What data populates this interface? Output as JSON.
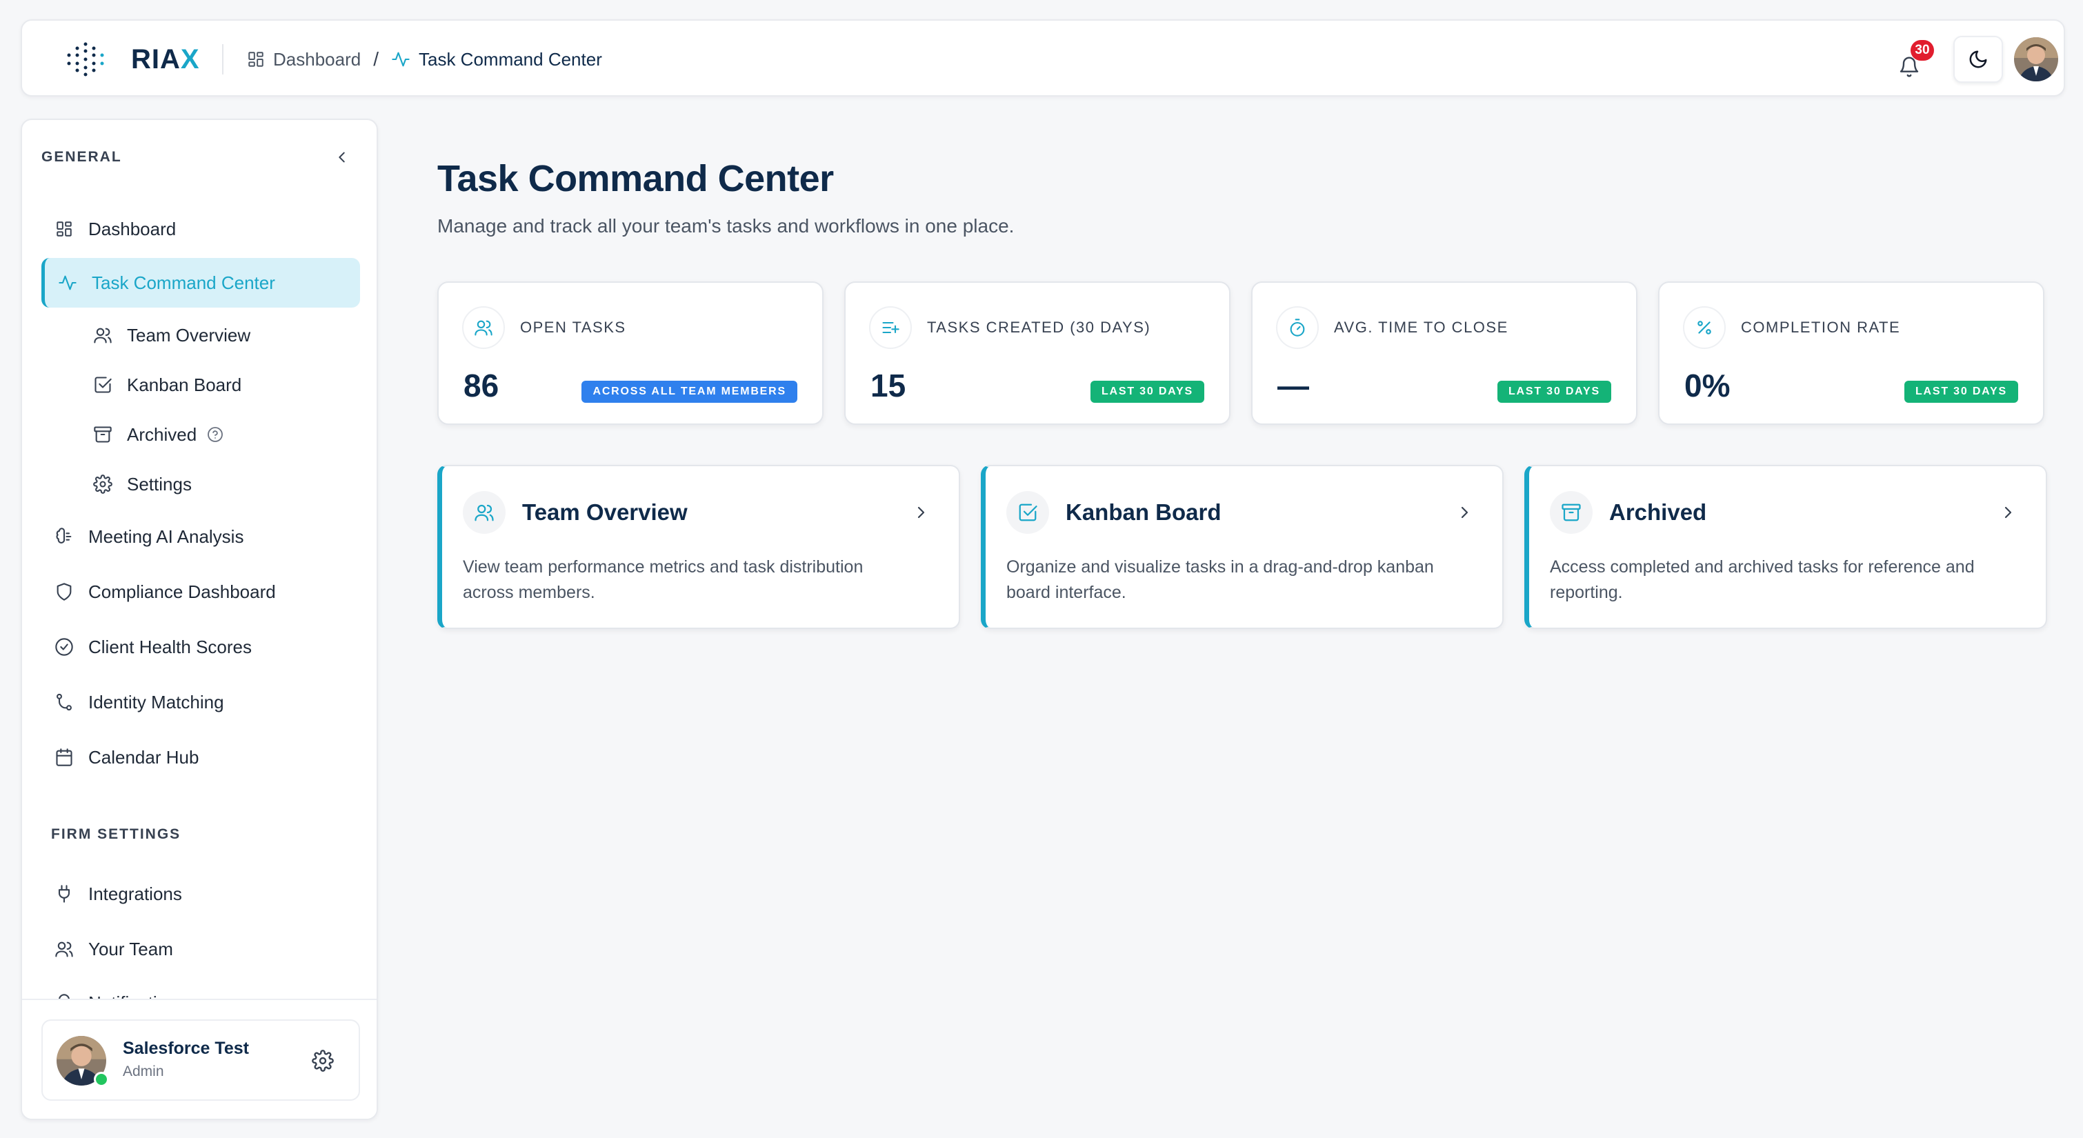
{
  "header": {
    "brand": "RIA",
    "brand_accent": "X",
    "breadcrumb": [
      {
        "label": "Dashboard"
      },
      {
        "label": "Task Command Center"
      }
    ],
    "breadcrumb_separator": "/",
    "notification_count": "30"
  },
  "sidebar": {
    "general_label": "GENERAL",
    "items": [
      {
        "label": "Dashboard"
      },
      {
        "label": "Task Command Center"
      },
      {
        "label": "Team Overview"
      },
      {
        "label": "Kanban Board"
      },
      {
        "label": "Archived"
      },
      {
        "label": "Settings"
      },
      {
        "label": "Meeting AI Analysis"
      },
      {
        "label": "Compliance Dashboard"
      },
      {
        "label": "Client Health Scores"
      },
      {
        "label": "Identity Matching"
      },
      {
        "label": "Calendar Hub"
      }
    ],
    "firm_settings_label": "FIRM SETTINGS",
    "firm_items": [
      {
        "label": "Integrations"
      },
      {
        "label": "Your Team"
      },
      {
        "label": "Notifications"
      }
    ],
    "user": {
      "name": "Salesforce Test",
      "role": "Admin"
    }
  },
  "main": {
    "title": "Task Command Center",
    "subtitle": "Manage and track all your team's tasks and workflows in one place.",
    "stats": [
      {
        "label": "OPEN TASKS",
        "value": "86",
        "badge": "ACROSS ALL TEAM MEMBERS",
        "badge_color": "#2f80ed"
      },
      {
        "label": "TASKS CREATED (30 DAYS)",
        "value": "15",
        "badge": "LAST 30 DAYS",
        "badge_color": "#14b377"
      },
      {
        "label": "AVG. TIME TO CLOSE",
        "value": "—",
        "badge": "LAST 30 DAYS",
        "badge_color": "#14b377"
      },
      {
        "label": "COMPLETION RATE",
        "value": "0%",
        "badge": "LAST 30 DAYS",
        "badge_color": "#14b377"
      }
    ],
    "cards": [
      {
        "title": "Team Overview",
        "description": "View team performance metrics and task distribution across members."
      },
      {
        "title": "Kanban Board",
        "description": "Organize and visualize tasks in a drag-and-drop kanban board interface."
      },
      {
        "title": "Archived",
        "description": "Access completed and archived tasks for reference and reporting."
      }
    ]
  },
  "colors": {
    "accent": "#1aa6c8",
    "navy": "#0f2a4a",
    "active_bg": "#d7f1f9",
    "badge_red": "#e11d2e"
  }
}
